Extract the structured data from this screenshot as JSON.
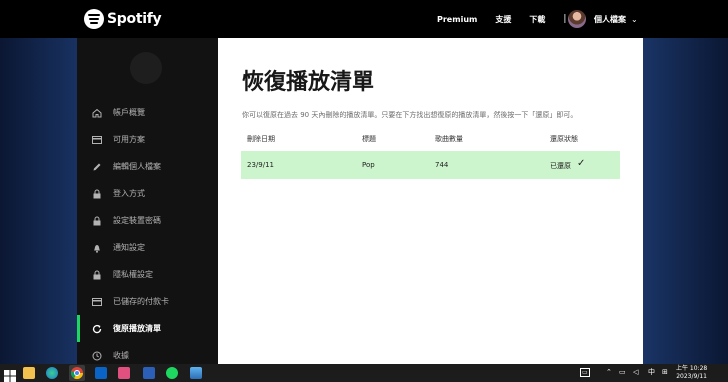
{
  "topnav": {
    "brand": "Spotify",
    "links": [
      "Premium",
      "支援",
      "下載"
    ],
    "separator": "|",
    "profile_label": "個人檔案"
  },
  "sidebar": {
    "items": [
      {
        "label": "帳戶概覽",
        "icon": "home-icon"
      },
      {
        "label": "可用方案",
        "icon": "card-icon"
      },
      {
        "label": "編輯個人檔案",
        "icon": "pen-icon"
      },
      {
        "label": "登入方式",
        "icon": "lock-icon"
      },
      {
        "label": "設定裝置密碼",
        "icon": "lock-icon"
      },
      {
        "label": "通知設定",
        "icon": "bell-icon"
      },
      {
        "label": "隱私權設定",
        "icon": "lock-icon"
      },
      {
        "label": "已儲存的付款卡",
        "icon": "card-icon"
      },
      {
        "label": "復原播放清單",
        "icon": "restore-icon",
        "active": true
      },
      {
        "label": "收據",
        "icon": "clock-icon"
      }
    ]
  },
  "main": {
    "title": "恢復播放清單",
    "description": "你可以復原在過去 90 天內刪除的播放清單。只要在下方找出想復原的播放清單，然後按一下「還原」即可。",
    "columns": [
      "刪除日期",
      "標題",
      "歌曲數量",
      "還原狀態"
    ],
    "rows": [
      {
        "date": "23/9/11",
        "title": "Pop",
        "count": "744",
        "status": "已還原",
        "status_icon": "✓"
      }
    ]
  },
  "taskbar": {
    "tray_ime": "中",
    "clock_line1": "上午 10:28",
    "clock_line2": "2023/9/11"
  },
  "colors": {
    "accent": "#1ed760",
    "row_restored": "#cdf5cd"
  }
}
